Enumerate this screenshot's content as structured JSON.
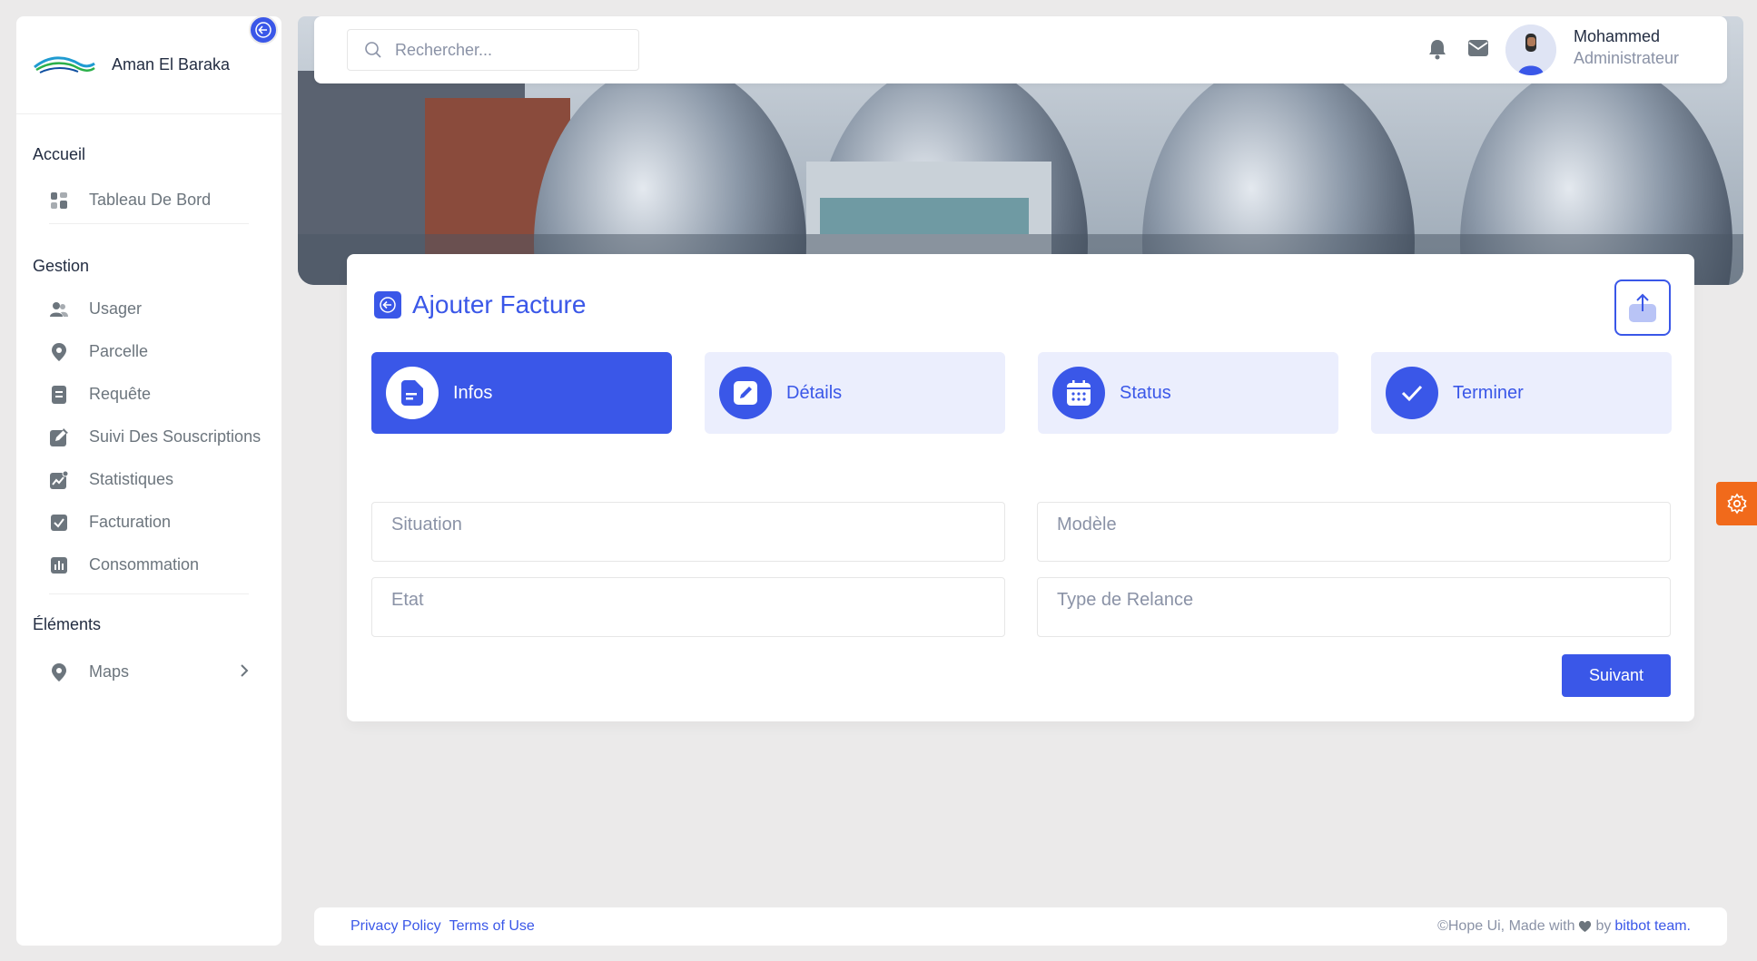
{
  "brand": {
    "name": "Aman El Baraka"
  },
  "sidebar": {
    "sections": [
      {
        "title": "Accueil"
      },
      {
        "title": "Gestion"
      },
      {
        "title": "Éléments"
      }
    ],
    "home_items": [
      {
        "label": "Tableau De Bord",
        "icon": "dashboard-icon"
      }
    ],
    "gestion_items": [
      {
        "label": "Usager",
        "icon": "users-icon"
      },
      {
        "label": "Parcelle",
        "icon": "location-pin-icon"
      },
      {
        "label": "Requête",
        "icon": "document-icon"
      },
      {
        "label": "Suivi Des Souscriptions",
        "icon": "edit-icon"
      },
      {
        "label": "Statistiques",
        "icon": "chart-icon"
      },
      {
        "label": "Facturation",
        "icon": "check-square-icon"
      },
      {
        "label": "Consommation",
        "icon": "bar-chart-icon"
      }
    ],
    "element_items": [
      {
        "label": "Maps",
        "icon": "map-pin-icon"
      }
    ]
  },
  "topbar": {
    "search_placeholder": "Rechercher...",
    "user_name": "Mohammed",
    "user_role": "Administrateur"
  },
  "card": {
    "title": "Ajouter Facture",
    "steps": [
      {
        "label": "Infos",
        "active": true
      },
      {
        "label": "Détails",
        "active": false
      },
      {
        "label": "Status",
        "active": false
      },
      {
        "label": "Terminer",
        "active": false
      }
    ],
    "fields": {
      "situation": "Situation",
      "modele": "Modèle",
      "etat": "Etat",
      "type_relance": "Type de Relance"
    },
    "next_label": "Suivant"
  },
  "footer": {
    "privacy": "Privacy Policy",
    "terms": "Terms of Use",
    "credit_prefix": "©Hope Ui, Made with",
    "credit_by": "by",
    "credit_team": "bitbot team."
  },
  "colors": {
    "primary": "#3a57e8",
    "accent": "#f16a1b",
    "background": "#ebeaea"
  }
}
